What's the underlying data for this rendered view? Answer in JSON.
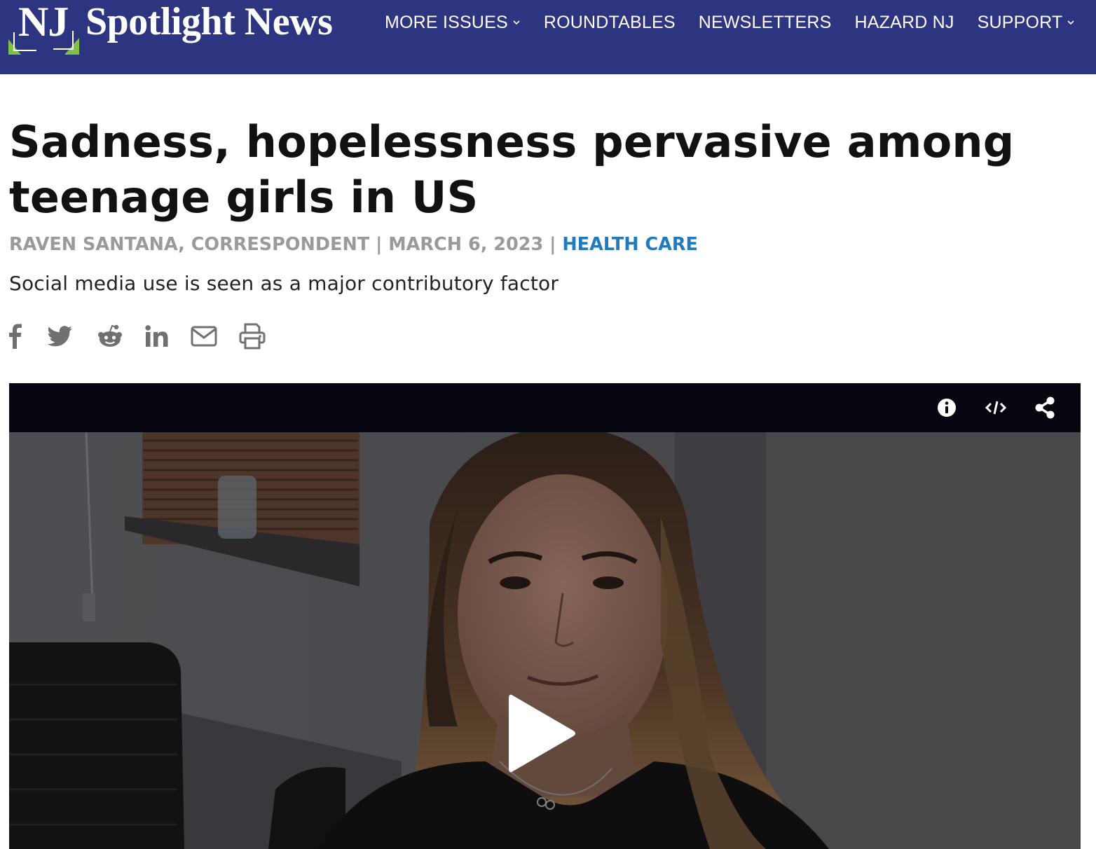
{
  "header": {
    "logo_nj": "NJ",
    "logo_name": "Spotlight News",
    "nav": [
      {
        "label": "MORE ISSUES",
        "has_dropdown": true
      },
      {
        "label": "ROUNDTABLES",
        "has_dropdown": false
      },
      {
        "label": "NEWSLETTERS",
        "has_dropdown": false
      },
      {
        "label": "HAZARD NJ",
        "has_dropdown": false
      },
      {
        "label": "SUPPORT",
        "has_dropdown": true
      }
    ],
    "colors": {
      "background": "#2d3580",
      "logo_accent": "#7dc242"
    }
  },
  "article": {
    "headline": "Sadness, hopelessness pervasive among teenage girls in US",
    "author": "RAVEN SANTANA, CORRESPONDENT",
    "separator": " | ",
    "date": "MARCH 6, 2023",
    "category": "HEALTH CARE",
    "dek": "Social media use is seen as a major contributory factor",
    "share_icons": [
      "facebook-icon",
      "twitter-icon",
      "reddit-icon",
      "linkedin-icon",
      "email-icon",
      "print-icon"
    ]
  },
  "video": {
    "toolbar_icons": [
      "info-icon",
      "embed-icon",
      "share-icon"
    ],
    "play_icon": "play-icon"
  }
}
